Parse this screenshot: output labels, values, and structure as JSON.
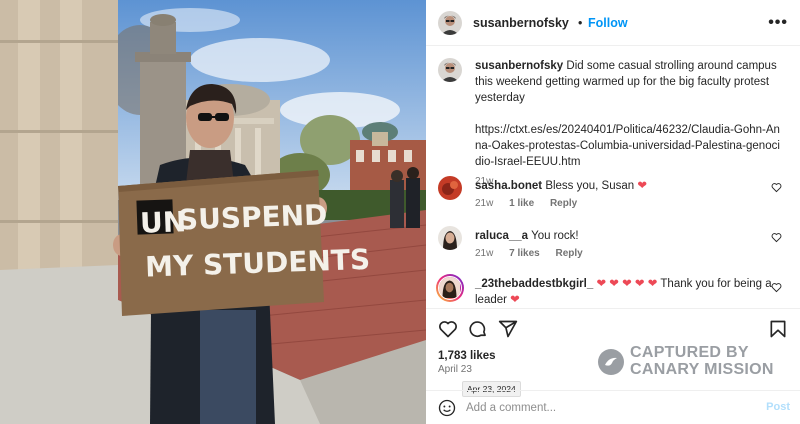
{
  "post": {
    "photo_alt": "",
    "sign_line1": "UNSUSPEND",
    "sign_line1_boxed": "UN",
    "sign_line1_rest": "SUSPEND",
    "sign_line2": "MY STUDENTS"
  },
  "header": {
    "username": "susanbernofsky",
    "separator": "•",
    "follow_label": "Follow",
    "more_icon": "more-horizontal-icon"
  },
  "caption": {
    "username": "susanbernofsky",
    "text": "Did some casual strolling around campus this weekend getting warmed up for the big faculty protest yesterday",
    "link": "https://ctxt.es/es/20240401/Politica/46232/Claudia-Gohn-Anna-Oakes-protestas-Columbia-universidad-Palestina-genocidio-Israel-EEUU.htm",
    "age": "21w"
  },
  "comments": [
    {
      "username": "sasha.bonet",
      "text": "Bless you, Susan ",
      "emoji": "❤",
      "age": "21w",
      "likes": "1 like",
      "reply": "Reply"
    },
    {
      "username": "raluca__a",
      "text": "You rock!",
      "emoji": "",
      "age": "21w",
      "likes": "7 likes",
      "reply": "Reply"
    },
    {
      "username": "_23thebaddestbkgirl_",
      "text": " Thank you for being a leader ",
      "emoji_lead": "❤ ❤ ❤ ❤ ❤",
      "emoji": "❤"
    }
  ],
  "actions": {
    "like_icon": "heart-icon",
    "comment_icon": "comment-icon",
    "share_icon": "send-icon",
    "save_icon": "bookmark-icon"
  },
  "stats": {
    "likes": "1,783 likes",
    "date": "April 23",
    "date_tooltip": "Apr 23, 2024"
  },
  "watermark": {
    "line1": "CAPTURED BY",
    "line2": "CANARY MISSION"
  },
  "comment_box": {
    "placeholder": "Add a comment...",
    "post_label": "Post"
  },
  "colors": {
    "accent": "#0095f6",
    "heart": "#ed4956",
    "post_disabled": "#b2dffc"
  }
}
